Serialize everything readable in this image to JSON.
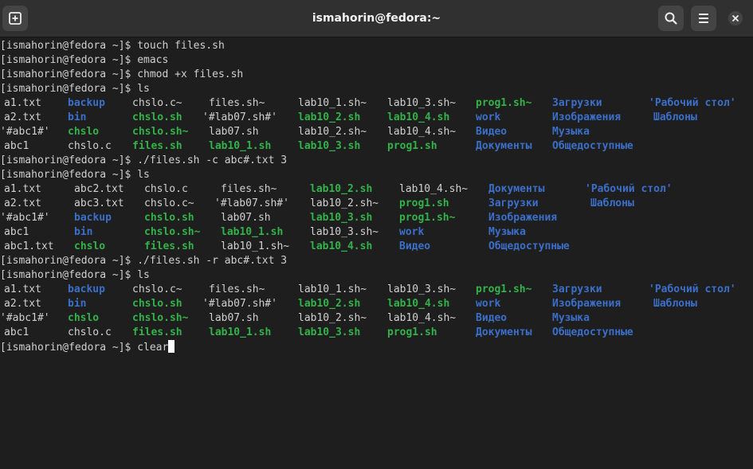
{
  "window": {
    "title": "ismahorin@fedora:~",
    "buttons": {
      "new_tab": "plus-square-icon",
      "search": "search-icon",
      "menu": "hamburger-menu-icon",
      "close": "close-icon"
    }
  },
  "colors": {
    "background": "#1e1e1e",
    "directory": "#3b6fc9",
    "executable": "#33b24a",
    "text": "#d0d0d0"
  },
  "terminal": {
    "prompt": "[ismahorin@fedora ~]$",
    "commands": [
      "touch files.sh",
      "emacs",
      "chmod +x files.sh",
      "ls",
      "./files.sh -c abc#.txt 3",
      "ls",
      "./files.sh -r abc#.txt 3",
      "ls",
      "clear"
    ],
    "listing1": [
      [
        "a1.txt",
        "backup",
        "chslo.c~",
        "files.sh~",
        "lab10_1.sh~",
        "lab10_3.sh~",
        "prog1.sh~",
        "Загрузки",
        "'Рабочий стол'"
      ],
      [
        "a2.txt",
        "bin",
        "chslo.sh",
        "'#lab07.sh#'",
        "lab10_2.sh",
        "lab10_4.sh",
        "work",
        "Изображения",
        "Шаблоны"
      ],
      [
        "'#abc1#'",
        "chslo",
        "chslo.sh~",
        "lab07.sh",
        "lab10_2.sh~",
        "lab10_4.sh~",
        "Видео",
        "Музыка"
      ],
      [
        "abc1",
        "chslo.c",
        "files.sh",
        "lab10_1.sh",
        "lab10_3.sh",
        "prog1.sh",
        "Документы",
        "Общедоступные"
      ]
    ],
    "listing2": [
      [
        "a1.txt",
        "abc2.txt",
        "chslo.c",
        "files.sh~",
        "lab10_2.sh",
        "lab10_4.sh~",
        "Документы",
        "'Рабочий стол'"
      ],
      [
        "a2.txt",
        "abc3.txt",
        "chslo.c~",
        "'#lab07.sh#'",
        "lab10_2.sh~",
        "prog1.sh",
        "Загрузки",
        "Шаблоны"
      ],
      [
        "'#abc1#'",
        "backup",
        "chslo.sh",
        "lab07.sh",
        "lab10_3.sh",
        "prog1.sh~",
        "Изображения"
      ],
      [
        "abc1",
        "bin",
        "chslo.sh~",
        "lab10_1.sh",
        "lab10_3.sh~",
        "work",
        "Музыка"
      ],
      [
        "abc1.txt",
        "chslo",
        "files.sh",
        "lab10_1.sh~",
        "lab10_4.sh",
        "Видео",
        "Общедоступные"
      ]
    ],
    "listing3": [
      [
        "a1.txt",
        "backup",
        "chslo.c~",
        "files.sh~",
        "lab10_1.sh~",
        "lab10_3.sh~",
        "prog1.sh~",
        "Загрузки",
        "'Рабочий стол'"
      ],
      [
        "a2.txt",
        "bin",
        "chslo.sh",
        "'#lab07.sh#'",
        "lab10_2.sh",
        "lab10_4.sh",
        "work",
        "Изображения",
        "Шаблоны"
      ],
      [
        "'#abc1#'",
        "chslo",
        "chslo.sh~",
        "lab07.sh",
        "lab10_2.sh~",
        "lab10_4.sh~",
        "Видео",
        "Музыка"
      ],
      [
        "abc1",
        "chslo.c",
        "files.sh",
        "lab10_1.sh",
        "lab10_3.sh",
        "prog1.sh",
        "Документы",
        "Общедоступные"
      ]
    ]
  }
}
